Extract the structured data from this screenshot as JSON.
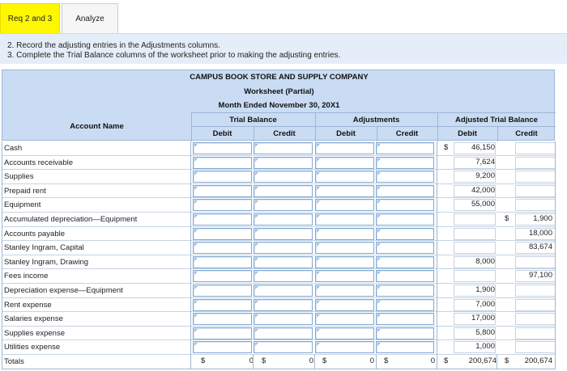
{
  "tabs": {
    "active_label": "Req 2 and 3",
    "inactive_label": "Analyze"
  },
  "instructions": {
    "line2": "2. Record the adjusting entries in the Adjustments columns.",
    "line3": "3. Complete the Trial Balance columns of the worksheet prior to making the adjusting entries."
  },
  "worksheet": {
    "company": "CAMPUS BOOK STORE AND SUPPLY COMPANY",
    "subtitle": "Worksheet (Partial)",
    "period": "Month Ended November 30, 20X1",
    "col_account": "Account Name",
    "group_trial": "Trial Balance",
    "group_adjust": "Adjustments",
    "group_adjusted": "Adjusted Trial Balance",
    "debit": "Debit",
    "credit": "Credit",
    "rows": [
      {
        "name": "Cash",
        "atb_debit_cur": "$",
        "atb_debit": "46,150",
        "atb_credit_cur": "",
        "atb_credit": ""
      },
      {
        "name": "Accounts receivable",
        "atb_debit_cur": "",
        "atb_debit": "7,624",
        "atb_credit_cur": "",
        "atb_credit": ""
      },
      {
        "name": "Supplies",
        "atb_debit_cur": "",
        "atb_debit": "9,200",
        "atb_credit_cur": "",
        "atb_credit": ""
      },
      {
        "name": "Prepaid rent",
        "atb_debit_cur": "",
        "atb_debit": "42,000",
        "atb_credit_cur": "",
        "atb_credit": ""
      },
      {
        "name": "Equipment",
        "atb_debit_cur": "",
        "atb_debit": "55,000",
        "atb_credit_cur": "",
        "atb_credit": ""
      },
      {
        "name": "Accumulated depreciation—Equipment",
        "atb_debit_cur": "",
        "atb_debit": "",
        "atb_credit_cur": "$",
        "atb_credit": "1,900"
      },
      {
        "name": "Accounts payable",
        "atb_debit_cur": "",
        "atb_debit": "",
        "atb_credit_cur": "",
        "atb_credit": "18,000"
      },
      {
        "name": "Stanley Ingram, Capital",
        "atb_debit_cur": "",
        "atb_debit": "",
        "atb_credit_cur": "",
        "atb_credit": "83,674"
      },
      {
        "name": "Stanley Ingram, Drawing",
        "atb_debit_cur": "",
        "atb_debit": "8,000",
        "atb_credit_cur": "",
        "atb_credit": ""
      },
      {
        "name": "Fees income",
        "atb_debit_cur": "",
        "atb_debit": "",
        "atb_credit_cur": "",
        "atb_credit": "97,100"
      },
      {
        "name": "Depreciation expense—Equipment",
        "atb_debit_cur": "",
        "atb_debit": "1,900",
        "atb_credit_cur": "",
        "atb_credit": ""
      },
      {
        "name": "Rent expense",
        "atb_debit_cur": "",
        "atb_debit": "7,000",
        "atb_credit_cur": "",
        "atb_credit": ""
      },
      {
        "name": "Salaries expense",
        "atb_debit_cur": "",
        "atb_debit": "17,000",
        "atb_credit_cur": "",
        "atb_credit": ""
      },
      {
        "name": "Supplies expense",
        "atb_debit_cur": "",
        "atb_debit": "5,800",
        "atb_credit_cur": "",
        "atb_credit": ""
      },
      {
        "name": "Utilities expense",
        "atb_debit_cur": "",
        "atb_debit": "1,000",
        "atb_credit_cur": "",
        "atb_credit": ""
      }
    ],
    "totals": {
      "label": "Totals",
      "cur": "$",
      "tb_debit": "0",
      "tb_credit": "0",
      "adj_debit": "0",
      "adj_credit": "0",
      "atb_debit": "200,674",
      "atb_credit": "200,674"
    }
  }
}
